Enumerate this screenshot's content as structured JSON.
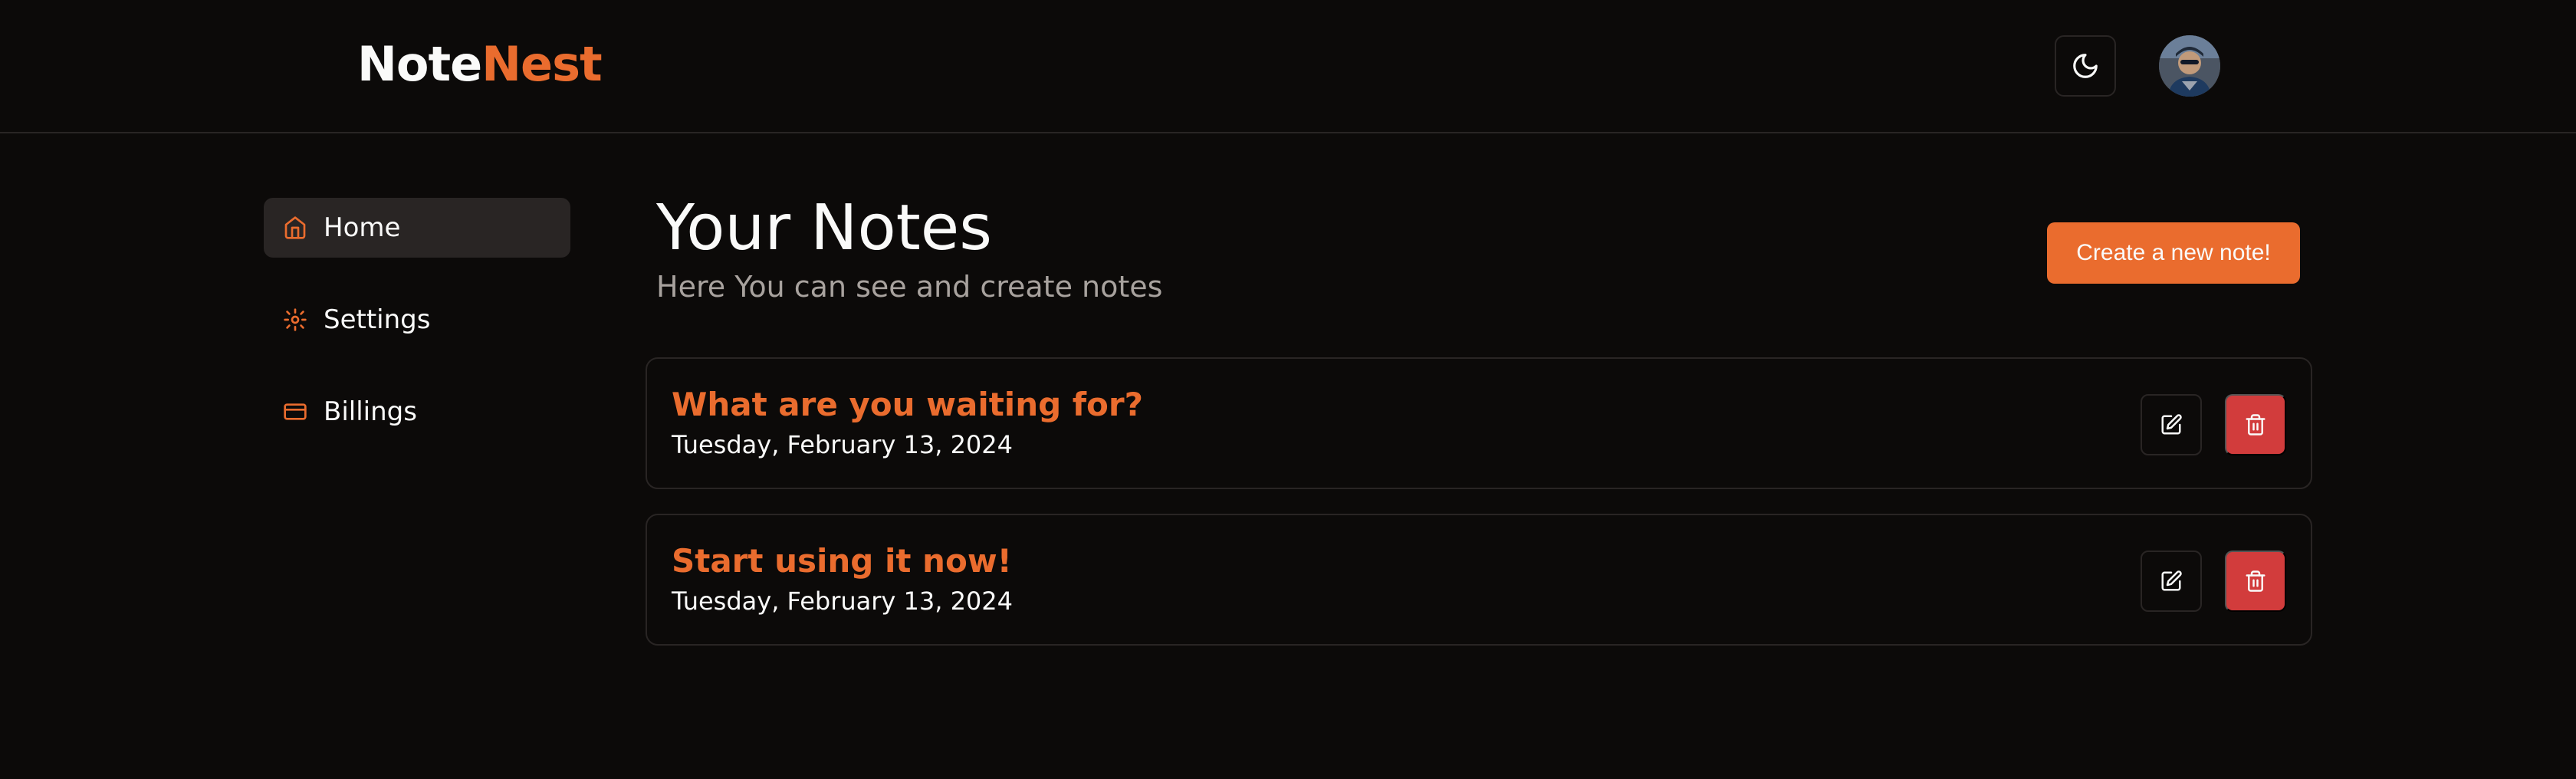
{
  "header": {
    "logo_part1": "Note",
    "logo_part2": "Nest",
    "theme_toggle_icon": "moon-icon",
    "avatar": "user-avatar"
  },
  "sidebar": {
    "items": [
      {
        "label": "Home",
        "icon": "home-icon",
        "active": true
      },
      {
        "label": "Settings",
        "icon": "gear-icon",
        "active": false
      },
      {
        "label": "Billings",
        "icon": "credit-card-icon",
        "active": false
      }
    ]
  },
  "main": {
    "title": "Your Notes",
    "subtitle": "Here You can see and create notes",
    "create_button": "Create a new note!"
  },
  "notes": [
    {
      "title": "What are you waiting for?",
      "date": "Tuesday, February 13, 2024"
    },
    {
      "title": "Start using it now!",
      "date": "Tuesday, February 13, 2024"
    }
  ],
  "colors": {
    "background": "#0c0a09",
    "accent": "#ea6c2e",
    "danger": "#d23c3c",
    "border": "#292524",
    "muted_text": "#a8a29e"
  }
}
